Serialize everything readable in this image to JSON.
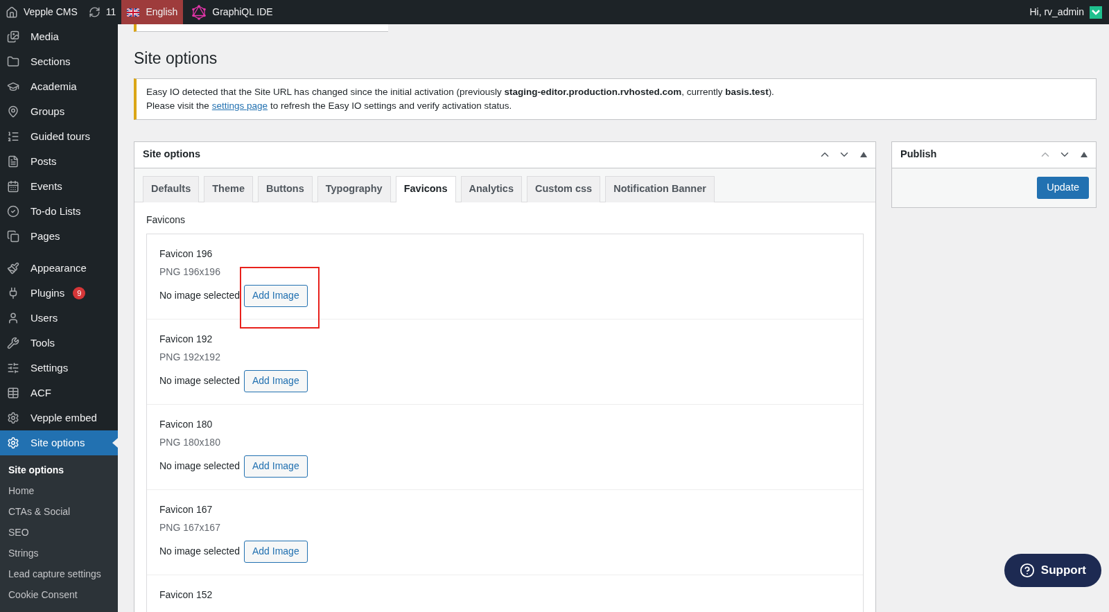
{
  "top_bar": {
    "site_name": "Vepple CMS",
    "updates_count": "11",
    "language": {
      "label": "English",
      "selected": true
    },
    "ide_link": "GraphiQL IDE",
    "greeting": "Hi, rv_admin"
  },
  "sidebar": {
    "groups": [
      [
        {
          "label": "Media",
          "kind": "media",
          "selected": false
        },
        {
          "label": "Sections",
          "kind": "folder",
          "selected": false
        },
        {
          "label": "Academia",
          "kind": "cap",
          "selected": false
        },
        {
          "label": "Groups",
          "kind": "pin",
          "selected": false
        },
        {
          "label": "Guided tours",
          "kind": "list",
          "selected": false
        },
        {
          "label": "Posts",
          "kind": "post",
          "selected": false
        },
        {
          "label": "Events",
          "kind": "calendar",
          "selected": false
        },
        {
          "label": "To-do Lists",
          "kind": "check",
          "selected": false
        },
        {
          "label": "Pages",
          "kind": "pages",
          "selected": false
        }
      ],
      [
        {
          "label": "Appearance",
          "kind": "brush",
          "selected": false
        },
        {
          "label": "Plugins",
          "kind": "plug",
          "selected": false,
          "badge": "9"
        },
        {
          "label": "Users",
          "kind": "user",
          "selected": false
        },
        {
          "label": "Tools",
          "kind": "wrench",
          "selected": false
        },
        {
          "label": "Settings",
          "kind": "sliders",
          "selected": false
        },
        {
          "label": "ACF",
          "kind": "table",
          "selected": false
        },
        {
          "label": "Vepple embed",
          "kind": "gear",
          "selected": false
        },
        {
          "label": "Site options",
          "kind": "gear",
          "selected": true
        }
      ]
    ],
    "submenu": [
      {
        "label": "Site options",
        "selected": true
      },
      {
        "label": "Home",
        "selected": false
      },
      {
        "label": "CTAs & Social",
        "selected": false
      },
      {
        "label": "SEO",
        "selected": false
      },
      {
        "label": "Strings",
        "selected": false
      },
      {
        "label": "Lead capture settings",
        "selected": false
      },
      {
        "label": "Cookie Consent",
        "selected": false
      }
    ]
  },
  "page_title": "Site options",
  "notice": {
    "line_1": "Easy IO detected that the Site URL has changed since the initial activation (previously **staging-editor.production.rvhosted.com**, currently **basis.test**).",
    "line_2_before": "Please visit the",
    "line_2_link": "settings page",
    "line_2_after": "to refresh the Easy IO settings and verify activation status."
  },
  "options_panel": {
    "title": "Site options",
    "tabs": [
      {
        "label": "Defaults",
        "selected": false
      },
      {
        "label": "Theme",
        "selected": false
      },
      {
        "label": "Buttons",
        "selected": false
      },
      {
        "label": "Typography",
        "selected": false
      },
      {
        "label": "Favicons",
        "selected": true
      },
      {
        "label": "Analytics",
        "selected": false
      },
      {
        "label": "Custom css",
        "selected": false
      },
      {
        "label": "Notification Banner",
        "selected": false
      }
    ],
    "section_label": "Favicons",
    "fields": [
      {
        "title": "Favicon 196",
        "format": "PNG 196x196",
        "status": "No image selected",
        "button": "Add Image",
        "highlighted": true
      },
      {
        "title": "Favicon 192",
        "format": "PNG 192x192",
        "status": "No image selected",
        "button": "Add Image",
        "highlighted": false
      },
      {
        "title": "Favicon 180",
        "format": "PNG 180x180",
        "status": "No image selected",
        "button": "Add Image",
        "highlighted": false
      },
      {
        "title": "Favicon 167",
        "format": "PNG 167x167",
        "status": "No image selected",
        "button": "Add Image",
        "highlighted": false
      },
      {
        "title": "Favicon 152",
        "highlighted": false
      }
    ]
  },
  "publish_panel": {
    "title": "Publish",
    "button": "Update"
  },
  "support_button": "Support"
}
